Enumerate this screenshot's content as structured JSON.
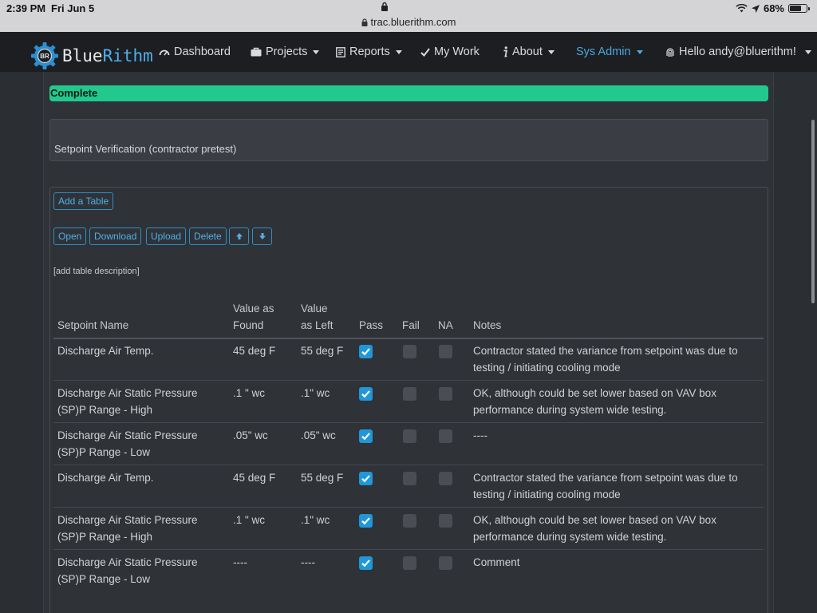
{
  "statusbar": {
    "time": "2:39 PM",
    "date": "Fri Jun 5",
    "battery": "68%",
    "battery_level": 0.68
  },
  "browser": {
    "url": "trac.bluerithm.com"
  },
  "brand": {
    "name_part1": "Blue",
    "name_part2": "Rithm",
    "logo_text": "BR"
  },
  "nav": {
    "dashboard": "Dashboard",
    "projects": "Projects",
    "reports": "Reports",
    "mywork": "My Work",
    "about": "About",
    "sysadmin": "Sys Admin",
    "user": "Hello andy@bluerithm!"
  },
  "status": {
    "label": "Complete",
    "color": "#21c98d"
  },
  "section": {
    "title": "Setpoint Verification (contractor pretest)"
  },
  "toolbar": {
    "add_table": "Add a Table",
    "open": "Open",
    "download": "Download",
    "upload": "Upload",
    "delete": "Delete"
  },
  "table": {
    "description": "[add table description]",
    "headers": {
      "name": "Setpoint Name",
      "found_1": "Value as",
      "found_2": "Found",
      "left_1": "Value",
      "left_2": "as Left",
      "pass": "Pass",
      "fail": "Fail",
      "na": "NA",
      "notes": "Notes"
    },
    "rows": [
      {
        "name_1": "Discharge Air Temp.",
        "name_2": "",
        "found": "45 deg F",
        "left": "55 deg F",
        "pass": true,
        "fail": false,
        "na": false,
        "notes_1": "Contractor stated the variance from setpoint was due to",
        "notes_2": "testing / initiating cooling mode"
      },
      {
        "name_1": "Discharge Air Static Pressure",
        "name_2": "(SP)P Range - High",
        "found": ".1 \" wc",
        "left": ".1\" wc",
        "pass": true,
        "fail": false,
        "na": false,
        "notes_1": "OK, although could be set lower based on VAV box",
        "notes_2": "performance during system wide testing."
      },
      {
        "name_1": "Discharge Air Static Pressure",
        "name_2": "(SP)P Range - Low",
        "found": ".05\" wc",
        "left": ".05\" wc",
        "pass": true,
        "fail": false,
        "na": false,
        "notes_1": "----",
        "notes_2": ""
      },
      {
        "name_1": "Discharge Air Temp.",
        "name_2": "",
        "found": "45 deg F",
        "left": "55 deg F",
        "pass": true,
        "fail": false,
        "na": false,
        "notes_1": "Contractor stated the variance from setpoint was due to",
        "notes_2": "testing / initiating cooling mode"
      },
      {
        "name_1": "Discharge Air Static Pressure",
        "name_2": "(SP)P Range - High",
        "found": ".1 \" wc",
        "left": ".1\" wc",
        "pass": true,
        "fail": false,
        "na": false,
        "notes_1": "OK, although could be set lower based on VAV box",
        "notes_2": "performance during system wide testing."
      },
      {
        "name_1": "Discharge Air Static Pressure",
        "name_2": "(SP)P Range - Low",
        "found": "----",
        "left": "----",
        "pass": true,
        "fail": false,
        "na": false,
        "notes_1": "Comment",
        "notes_2": ""
      }
    ]
  },
  "colors": {
    "accent": "#4fb0ea",
    "checkbox_on": "#1f97d9",
    "navbar": "#1c1e21",
    "background": "#2b2e33"
  }
}
